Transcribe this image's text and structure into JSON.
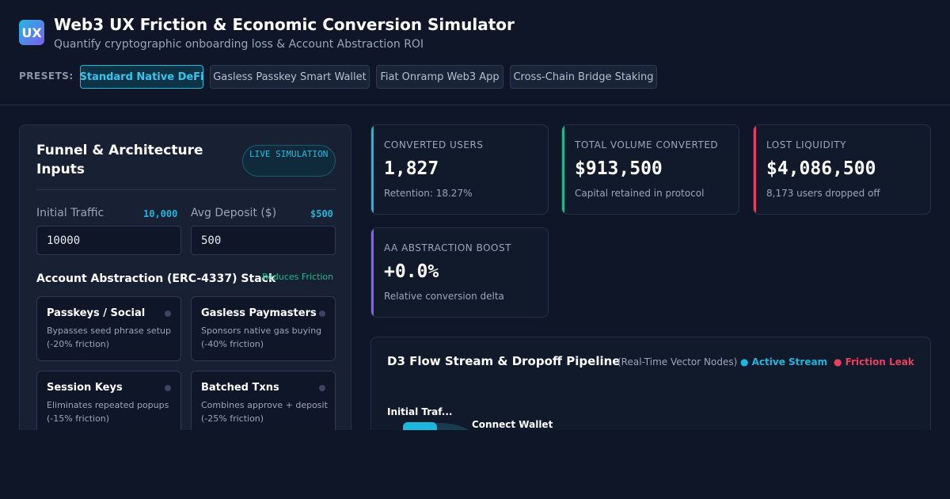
{
  "app": {
    "logo": "UX",
    "title": "Web3 UX Friction & Economic Conversion Simulator",
    "subtitle": "Quantify cryptographic onboarding loss & Account Abstraction ROI"
  },
  "presets": {
    "label": "PRESETS:",
    "items": [
      {
        "label": "Standard Native DeFi",
        "active": true
      },
      {
        "label": "Gasless Passkey Smart Wallet",
        "active": false
      },
      {
        "label": "Fiat Onramp Web3 App",
        "active": false
      },
      {
        "label": "Cross-Chain Bridge Staking",
        "active": false
      }
    ]
  },
  "inputs_panel": {
    "title": "Funnel & Architecture Inputs",
    "badge": "LIVE SIMULATION",
    "traffic": {
      "label": "Initial Traffic",
      "display": "10,000",
      "value": "10000"
    },
    "deposit": {
      "label": "Avg Deposit ($)",
      "display": "$500",
      "value": "500"
    },
    "stack_title": "Account Abstraction (ERC-4337) Stack",
    "stack_hint": "Reduces Friction",
    "cards": [
      {
        "title": "Passkeys / Social",
        "desc": "Bypasses seed phrase setup (-20% friction)",
        "enabled": false
      },
      {
        "title": "Gasless Paymasters",
        "desc": "Sponsors native gas buying (-40% friction)",
        "enabled": false
      },
      {
        "title": "Session Keys",
        "desc": "Eliminates repeated popups (-15% friction)",
        "enabled": false
      },
      {
        "title": "Batched Txns",
        "desc": "Combines approve + deposit (-25% friction)",
        "enabled": false
      }
    ]
  },
  "stats": [
    {
      "label": "CONVERTED USERS",
      "value": "1,827",
      "note": "Retention: 18.27%",
      "accent": "#1fb6dc"
    },
    {
      "label": "TOTAL VOLUME CONVERTED",
      "value": "$913,500",
      "note": "Capital retained in protocol",
      "accent": "#20b88a"
    },
    {
      "label": "LOST LIQUIDITY",
      "value": "$4,086,500",
      "note": "8,173 users dropped off",
      "accent": "#e8405e"
    },
    {
      "label": "AA ABSTRACTION BOOST",
      "value": "+0.0%",
      "note": "Relative conversion delta",
      "accent": "#8b5cf6"
    }
  ],
  "flow": {
    "title": "D3 Flow Stream & Dropoff Pipeline",
    "subtitle": "(Real-Time Vector Nodes)",
    "legend_active": "● Active Stream",
    "legend_leak": "● Friction Leak",
    "active_color": "#1fb6dc",
    "leak_color": "#e8405e",
    "nodes": [
      "Initial Traf...",
      "Connect Wallet"
    ]
  }
}
